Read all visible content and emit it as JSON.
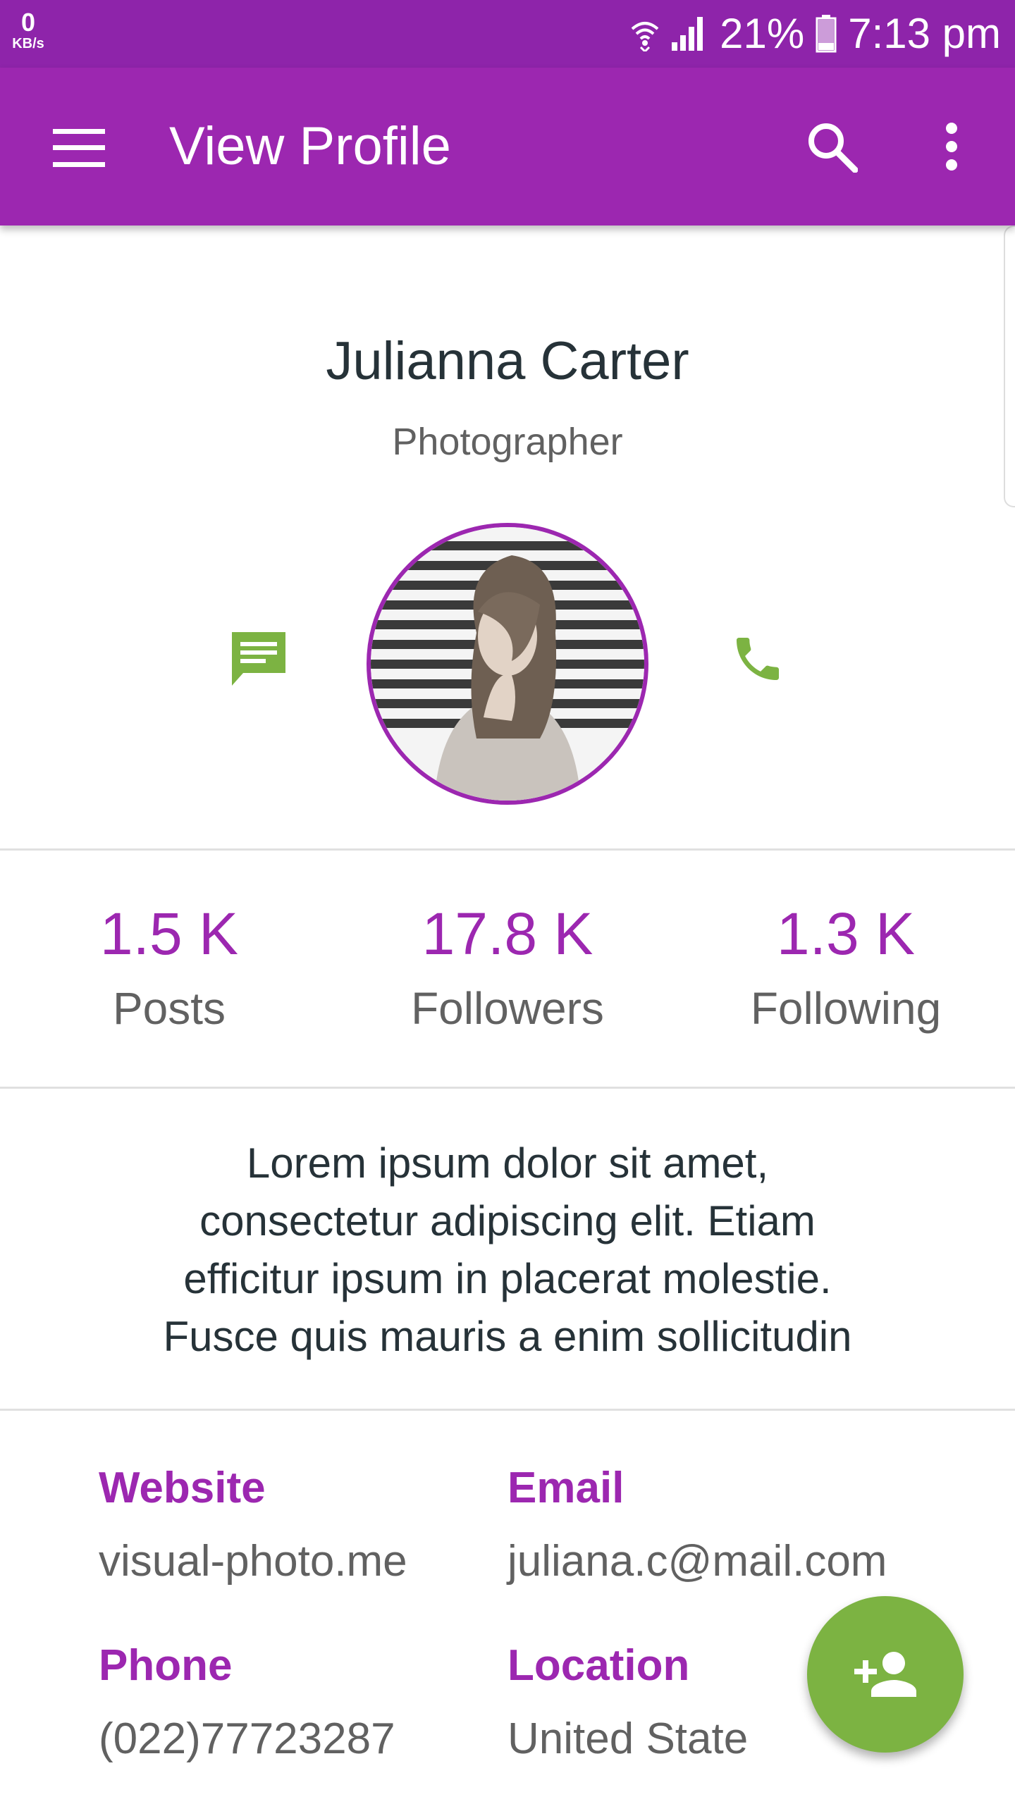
{
  "status_bar": {
    "net_speed": "0",
    "net_unit": "KB/s",
    "battery": "21%",
    "time": "7:13 pm"
  },
  "app_bar": {
    "title": "View Profile",
    "icons": [
      "menu-icon",
      "search-icon",
      "more-vert-icon"
    ]
  },
  "profile": {
    "name": "Julianna Carter",
    "role": "Photographer",
    "actions": [
      "message-icon",
      "phone-icon"
    ]
  },
  "stats": [
    {
      "value": "1.5 K",
      "label": "Posts"
    },
    {
      "value": "17.8 K",
      "label": "Followers"
    },
    {
      "value": "1.3 K",
      "label": "Following"
    }
  ],
  "bio": {
    "lines": [
      "Lorem ipsum dolor sit amet,",
      "consectetur adipiscing elit. Etiam",
      "efficitur ipsum in placerat molestie.",
      "Fusce quis mauris a enim sollicitudin"
    ]
  },
  "info": {
    "website_label": "Website",
    "website_value": "visual-photo.me",
    "email_label": "Email",
    "email_value": "juliana.c@mail.com",
    "phone_label": "Phone",
    "phone_value": "(022)77723287",
    "location_label": "Location",
    "location_value": "United State"
  },
  "fab": {
    "icon": "person-add-icon"
  },
  "colors": {
    "status_bar": "#8e24aa",
    "primary": "#9c27b0",
    "accent": "#7cb342",
    "text_dark": "#263238",
    "text_secondary": "#616161",
    "divider": "#e0e0e0"
  }
}
